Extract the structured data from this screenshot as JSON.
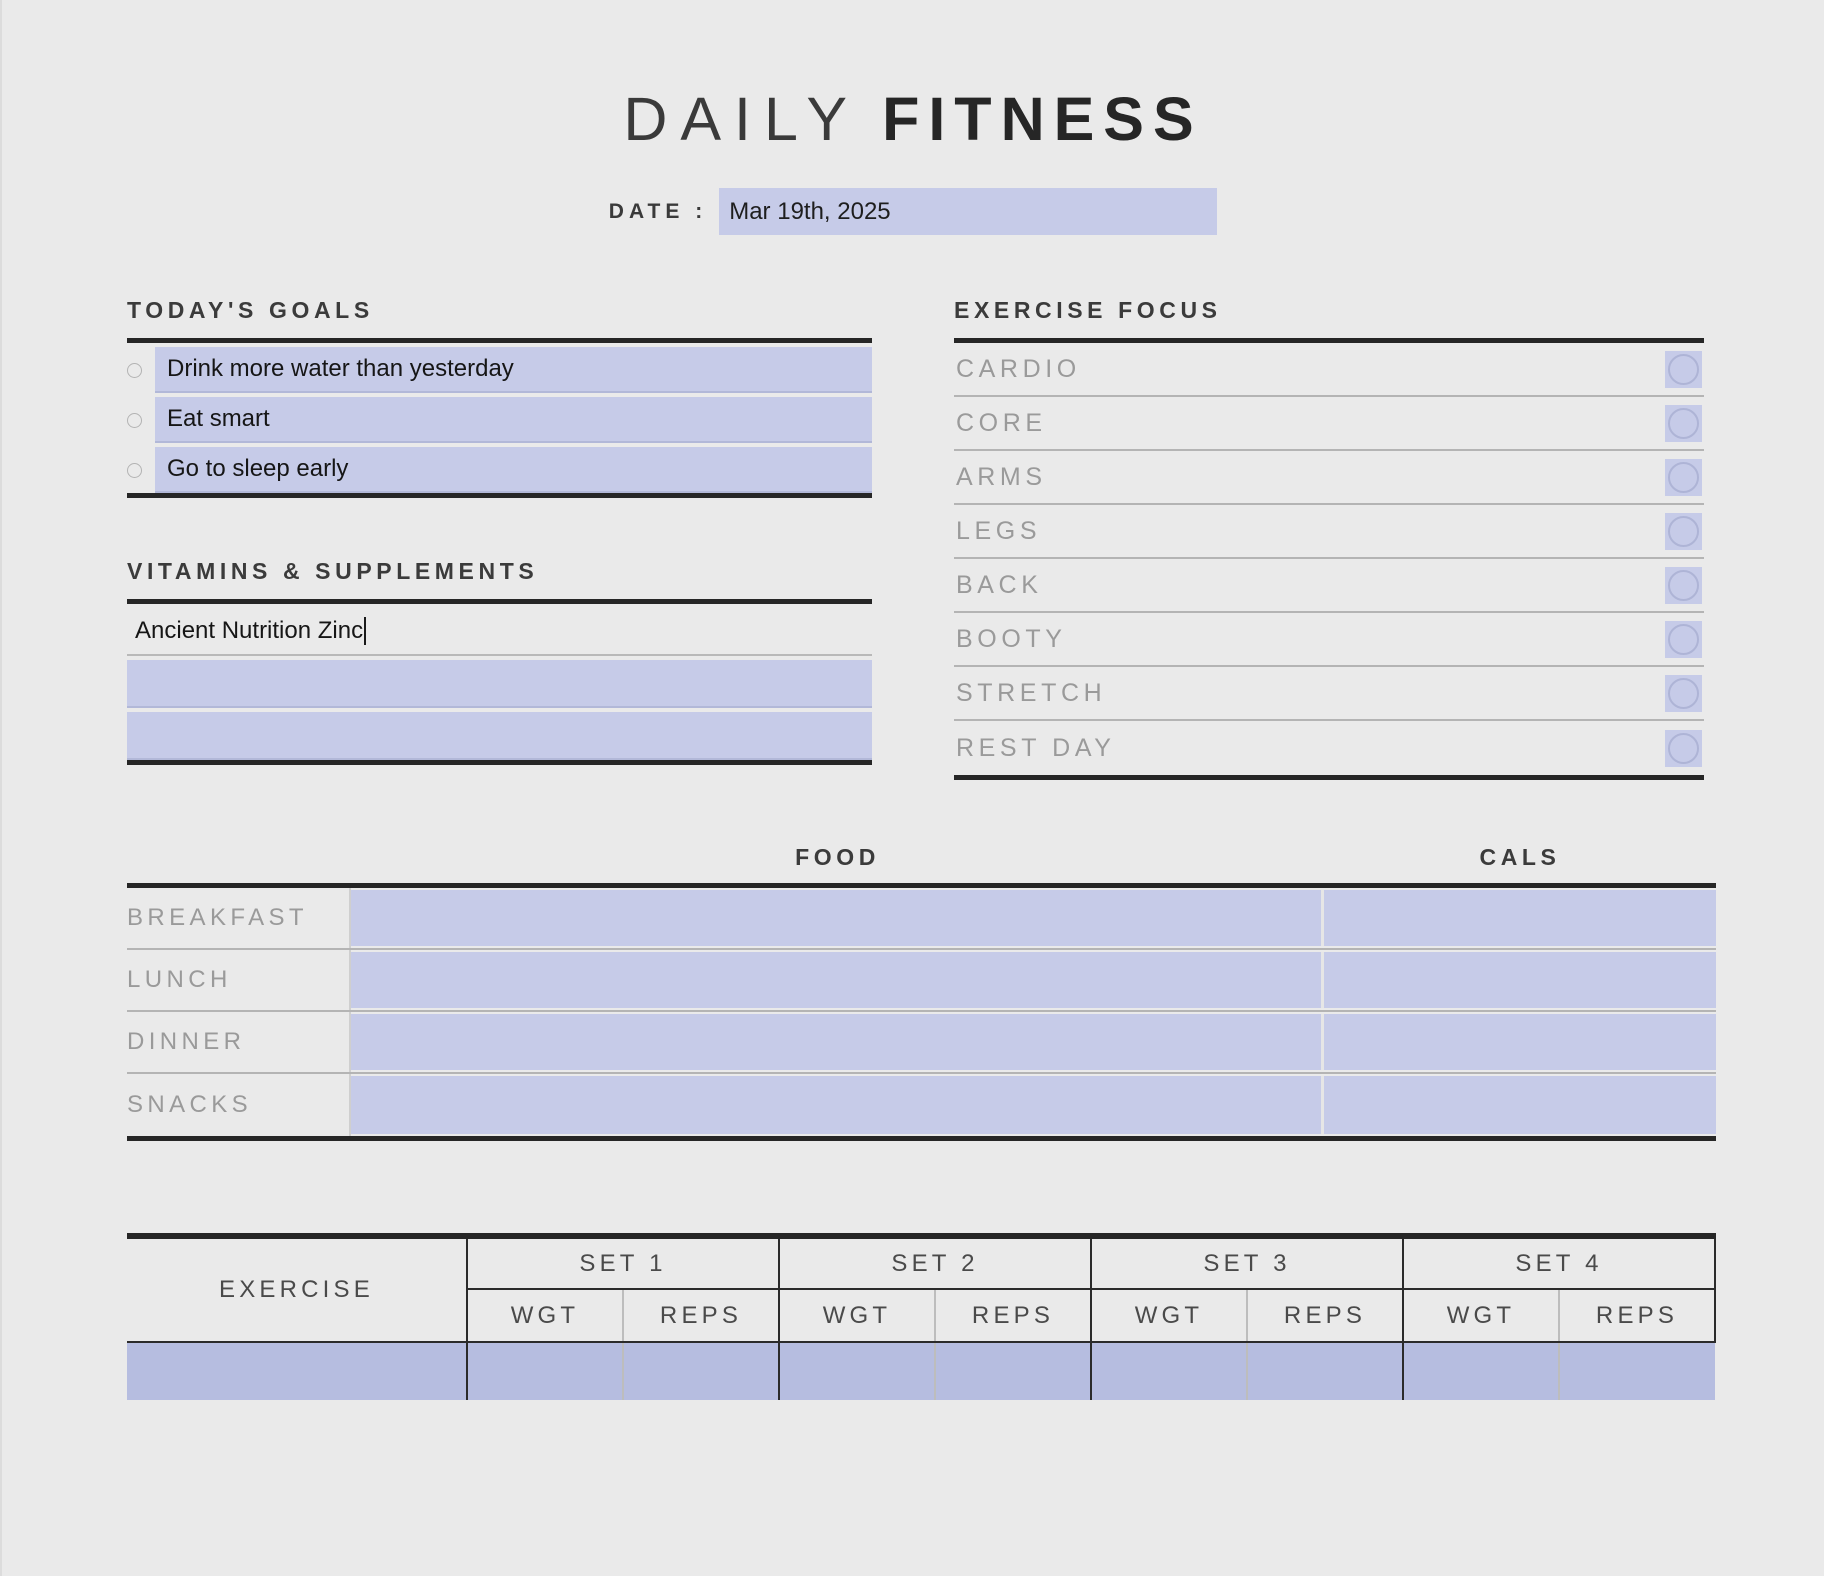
{
  "title": {
    "part1": "DAILY",
    "part2": "FITNESS"
  },
  "date": {
    "label": "DATE :",
    "value": "Mar 19th, 2025"
  },
  "goals": {
    "heading": "TODAY'S GOALS",
    "items": [
      {
        "text": "Drink more water than yesterday",
        "checked": false
      },
      {
        "text": "Eat smart",
        "checked": false
      },
      {
        "text": "Go to sleep early",
        "checked": false
      }
    ]
  },
  "vitamins": {
    "heading": "VITAMINS & SUPPLEMENTS",
    "items": [
      {
        "text": "Ancient Nutrition Zinc",
        "focused": true
      },
      {
        "text": "",
        "focused": false
      },
      {
        "text": "",
        "focused": false
      }
    ]
  },
  "exercise_focus": {
    "heading": "EXERCISE FOCUS",
    "items": [
      {
        "label": "CARDIO",
        "selected": false
      },
      {
        "label": "CORE",
        "selected": false
      },
      {
        "label": "ARMS",
        "selected": false
      },
      {
        "label": "LEGS",
        "selected": false
      },
      {
        "label": "BACK",
        "selected": false
      },
      {
        "label": "BOOTY",
        "selected": false
      },
      {
        "label": "STRETCH",
        "selected": false
      },
      {
        "label": "REST DAY",
        "selected": false
      }
    ]
  },
  "food": {
    "headers": {
      "meal": "",
      "food": "FOOD",
      "cals": "CALS"
    },
    "rows": [
      {
        "meal": "BREAKFAST",
        "food": "",
        "cals": ""
      },
      {
        "meal": "LUNCH",
        "food": "",
        "cals": ""
      },
      {
        "meal": "DINNER",
        "food": "",
        "cals": ""
      },
      {
        "meal": "SNACKS",
        "food": "",
        "cals": ""
      }
    ]
  },
  "workout": {
    "exercise_header": "EXERCISE",
    "sets": [
      "SET 1",
      "SET 2",
      "SET 3",
      "SET 4"
    ],
    "sub_headers": [
      "WGT",
      "REPS"
    ],
    "rows": [
      {
        "exercise": "",
        "values": [
          "",
          "",
          "",
          "",
          "",
          "",
          "",
          ""
        ]
      }
    ]
  },
  "colors": {
    "background": "#eaeaea",
    "field": "#c6cbe8",
    "field_deep": "#b6bde0",
    "rule": "#262626",
    "muted_text": "#9a9a9a"
  }
}
